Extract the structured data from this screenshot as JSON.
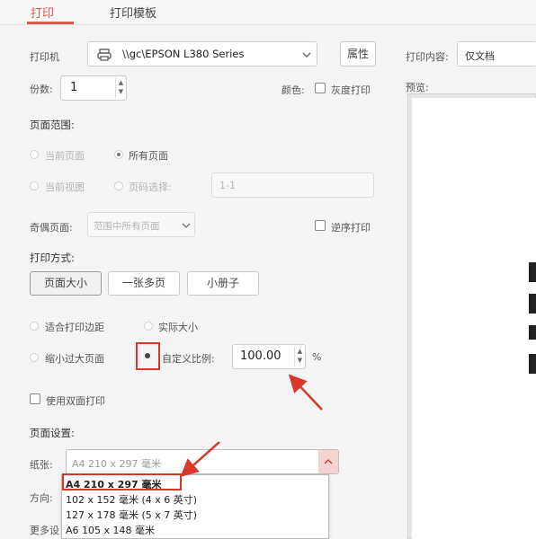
{
  "tabs": [
    {
      "label": "打印"
    },
    {
      "label": "打印模板"
    }
  ],
  "printer": {
    "label": "打印机",
    "name": "\\\\gc\\EPSON L380 Series",
    "properties": "属性"
  },
  "copies": {
    "label": "份数:",
    "value": "1"
  },
  "collate": {
    "label": "颜色:",
    "grayscale": "灰度打印"
  },
  "print_content": {
    "label": "打印内容:",
    "value": "仅文档"
  },
  "preview": {
    "label": "预览:"
  },
  "page_range": {
    "title": "页面范围:",
    "current": "当前页面",
    "all": "所有页面",
    "selection": "当前视图",
    "pages": "页码选择:",
    "pages_value": "1-1"
  },
  "odd_even": {
    "label": "奇偶页面:",
    "value": "范围中所有页面",
    "reverse": "逆序打印"
  },
  "print_mode": {
    "title": "打印方式:",
    "page_size": "页面大小",
    "multi": "一张多页",
    "booklet": "小册子"
  },
  "scaling": {
    "fit_margin": "适合打印边距",
    "actual": "实际大小",
    "shrink": "缩小过大页面",
    "custom": "自定义比例:",
    "custom_value": "100.00",
    "unit": "%"
  },
  "duplex": {
    "label": "使用双面打印"
  },
  "page_setup": {
    "title": "页面设置:",
    "paper_label": "纸张:",
    "paper_value": "A4 210 x 297 毫米",
    "orientation_label": "方向:",
    "more_label": "更多设"
  },
  "paper_options": [
    {
      "label": "A4 210 x 297 毫米"
    },
    {
      "label": "102 x 152 毫米 (4 x 6 英寸)"
    },
    {
      "label": "127 x 178 毫米 (5 x 7 英寸)"
    },
    {
      "label": "A6 105 x 148 毫米"
    }
  ],
  "colors": {
    "accent": "#e2574c",
    "highlight": "#d9372b"
  }
}
